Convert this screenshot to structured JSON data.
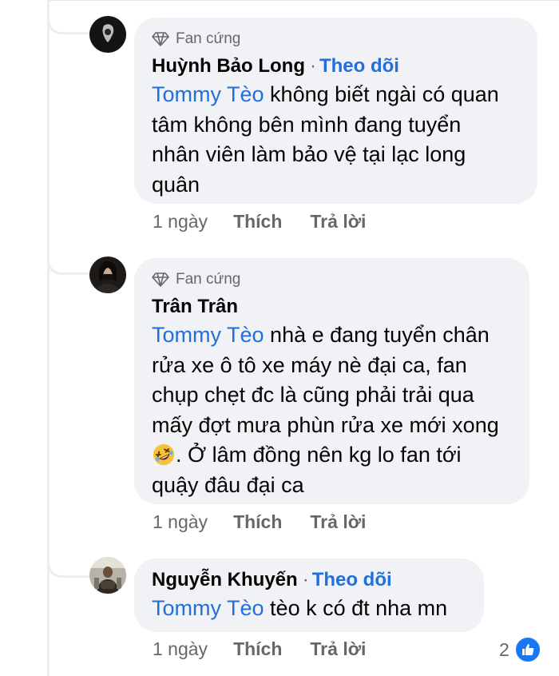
{
  "comments": [
    {
      "badge": "Fan cứng",
      "author": "Huỳnh Bảo Long",
      "separator": "·",
      "follow": "Theo dõi",
      "mention": "Tommy Tèo",
      "lines": [
        " không biết ngài có quan",
        "tâm không bên mình đang tuyển",
        "nhân viên làm bảo vệ tại lạc long",
        "quân"
      ],
      "time": "1 ngày",
      "like": "Thích",
      "reply": "Trả lời"
    },
    {
      "badge": "Fan cứng",
      "author": "Trân Trân",
      "mention": "Tommy Tèo",
      "lines": [
        " nhà e đang tuyển chân",
        "rửa xe ô tô xe máy nè đại ca, fan",
        "chụp chẹt đc là cũng phải trải qua",
        "mấy đợt mưa phùn rửa xe mới xong"
      ],
      "line5_after_emoji": ". Ở lâm đồng nên kg lo fan tới",
      "line6": "quậy đâu đại ca",
      "emoji": "rolling-on-the-floor-laughing",
      "time": "1 ngày",
      "like": "Thích",
      "reply": "Trả lời"
    },
    {
      "author": "Nguyễn Khuyến",
      "separator": "·",
      "follow": "Theo dõi",
      "mention": "Tommy Tèo",
      "text": " tèo k có đt nha mn",
      "time": "1 ngày",
      "like": "Thích",
      "reply": "Trả lời",
      "reaction_count": "2",
      "reaction_icon": "like-icon"
    }
  ],
  "colors": {
    "bubble": "#f0f2f5",
    "link": "#216fdb",
    "meta": "#65676b",
    "like": "#1877f2"
  }
}
